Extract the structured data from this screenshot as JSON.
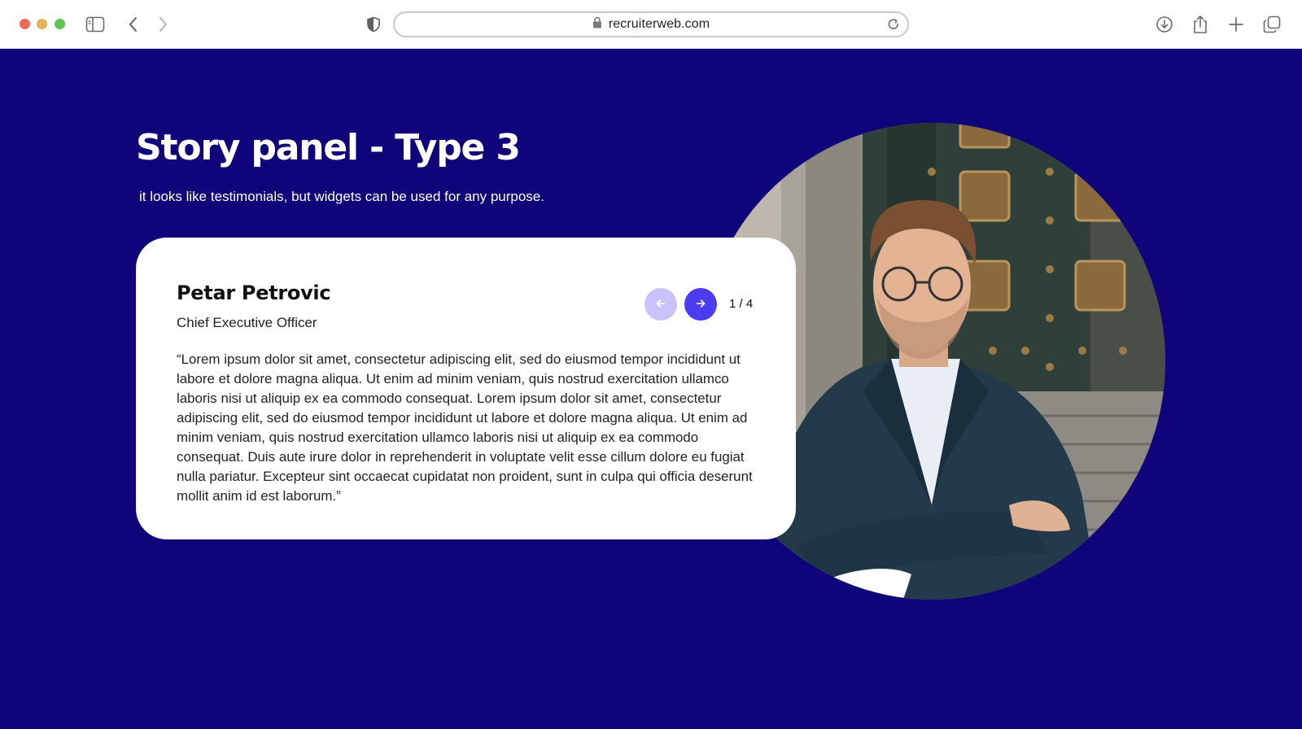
{
  "browser": {
    "url": "recruiterweb.com",
    "icons": [
      "sidebar-icon",
      "back-icon",
      "forward-icon",
      "shield-icon",
      "lock-icon",
      "reload-icon",
      "download-icon",
      "share-icon",
      "new-tab-icon",
      "tabs-overview-icon"
    ]
  },
  "page": {
    "title": "Story panel - Type 3",
    "subtitle": "it looks like testimonials, but widgets can be used for any purpose.",
    "background_color": "#10047a"
  },
  "story": {
    "name": "Petar Petrovic",
    "role": "Chief Executive Officer",
    "quote": "“Lorem ipsum dolor sit amet, consectetur adipiscing elit, sed do eiusmod tempor incididunt ut labore et dolore magna aliqua. Ut enim ad minim veniam, quis nostrud exercitation ullamco laboris nisi ut aliquip ex ea commodo consequat.  Lorem ipsum dolor sit amet, consectetur adipiscing elit, sed do eiusmod tempor incididunt ut labore et dolore magna aliqua. Ut enim ad minim veniam, quis nostrud exercitation ullamco laboris nisi ut aliquip ex ea commodo consequat. Duis aute irure dolor in reprehenderit in voluptate velit esse cillum dolore eu fugiat nulla pariatur. Excepteur sint occaecat cupidatat non proident, sunt in culpa qui officia deserunt mollit anim id est laborum.”",
    "pager": "1 / 4",
    "prev_icon": "arrow-left-icon",
    "next_icon": "arrow-right-icon",
    "accent_color": "#4b3cf0",
    "accent_disabled_color": "#c9c3fb"
  }
}
